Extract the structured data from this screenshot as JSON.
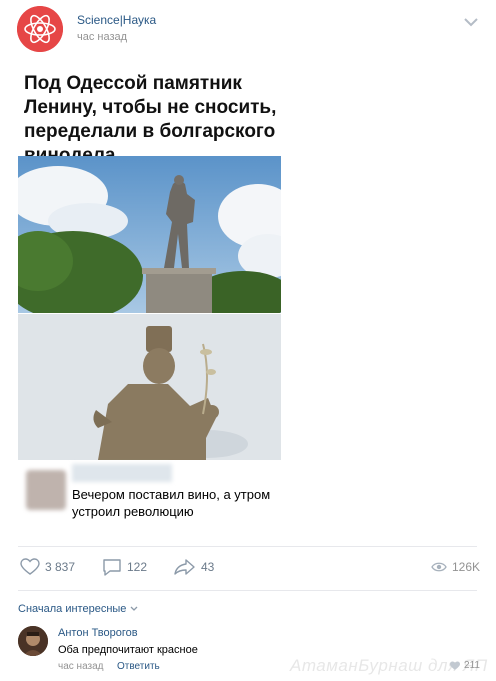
{
  "post": {
    "group_name": "Science|Наука",
    "time": "час назад",
    "text": "Под Одессой памятник Ленину, чтобы не сносить, переделали в болгарского винодела."
  },
  "meme": {
    "caption": "Вечером поставил вино, а утром устроил революцию"
  },
  "actions": {
    "likes": "3 837",
    "comments": "122",
    "shares": "43",
    "views": "126K"
  },
  "comments": {
    "sort_label": "Сначала интересные",
    "items": [
      {
        "author": "Антон Творогов",
        "text": "Оба предпочитают красное",
        "time": "час назад",
        "reply_label": "Ответить",
        "likes": "211"
      }
    ]
  },
  "watermark": "АтаманБурнаш для ЯП",
  "colors": {
    "link": "#2a5885",
    "muted": "#939393",
    "avatar": "#e64646"
  }
}
